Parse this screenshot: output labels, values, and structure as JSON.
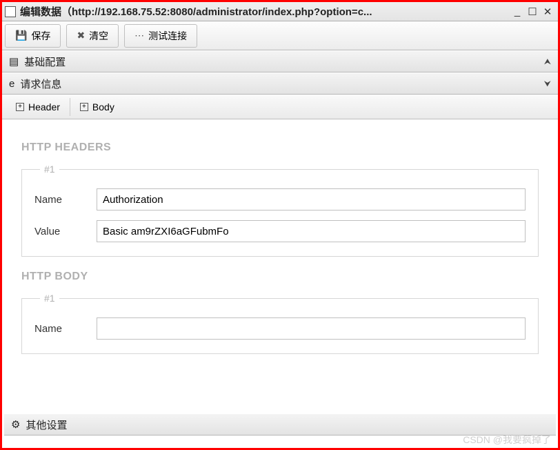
{
  "window": {
    "title": "编辑数据（http://192.168.75.52:8080/administrator/index.php?option=c..."
  },
  "toolbar": {
    "save": "保存",
    "clear": "清空",
    "test": "测试连接"
  },
  "accordion": {
    "basic": "基础配置",
    "request": "请求信息",
    "other": "其他设置"
  },
  "subtoolbar": {
    "header": "Header",
    "body": "Body"
  },
  "sections": {
    "headers_title": "HTTP HEADERS",
    "body_title": "HTTP BODY",
    "group_label": "#1",
    "name_label": "Name",
    "value_label": "Value"
  },
  "headers": [
    {
      "name": "Authorization",
      "value": "Basic am9rZXI6aGFubmFo"
    }
  ],
  "body_items": [
    {
      "name": "",
      "value": ""
    }
  ],
  "watermark": "CSDN @我要疯掉了"
}
